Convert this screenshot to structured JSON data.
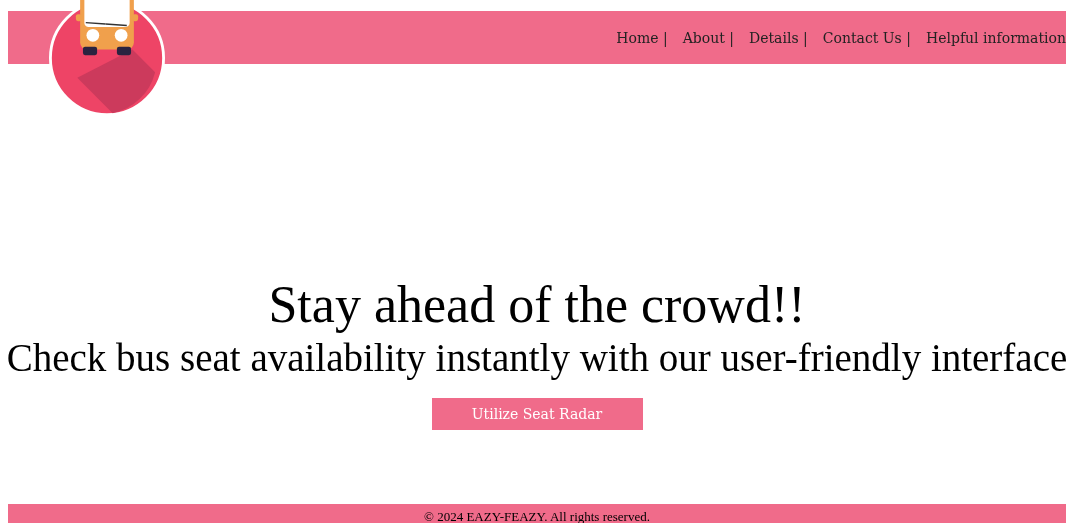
{
  "nav": {
    "links": [
      {
        "label": "Home |"
      },
      {
        "label": "About |"
      },
      {
        "label": "Details |"
      },
      {
        "label": "Contact Us |"
      },
      {
        "label": "Helpful information"
      }
    ]
  },
  "hero": {
    "title": "Stay ahead of the crowd!!",
    "subtitle": "Check bus seat availability instantly with our user-friendly interface",
    "button": "Utilize Seat Radar"
  },
  "footer": {
    "text": "© 2024 EAZY-FEAZY. All rights reserved."
  }
}
